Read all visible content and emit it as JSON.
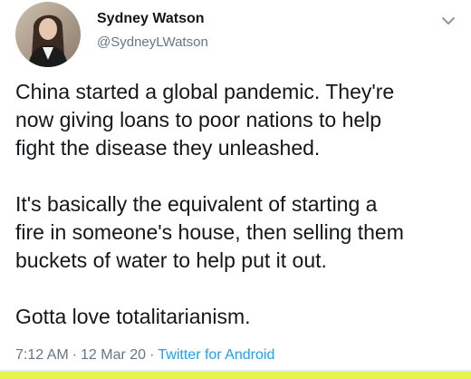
{
  "tweet": {
    "author": {
      "display_name": "Sydney Watson",
      "handle": "@SydneyLWatson",
      "avatar_icon": "profile-photo"
    },
    "menu_icon": "chevron-down-icon",
    "paragraphs": [
      "China started a global pandemic. They're\nnow giving loans to poor nations to help\nfight the disease they unleashed.",
      "It's basically the equivalent of starting a\nfire in someone's house, then selling them\nbuckets of water to help put it out.",
      "Gotta love totalitarianism."
    ],
    "meta": {
      "time": "7:12 AM",
      "separator": "·",
      "date": "12 Mar 20",
      "source": "Twitter for Android"
    }
  },
  "colors": {
    "text_primary": "#14171a",
    "text_secondary": "#657786",
    "link": "#1da1f2",
    "bottom_accent": "#e6f44a"
  }
}
